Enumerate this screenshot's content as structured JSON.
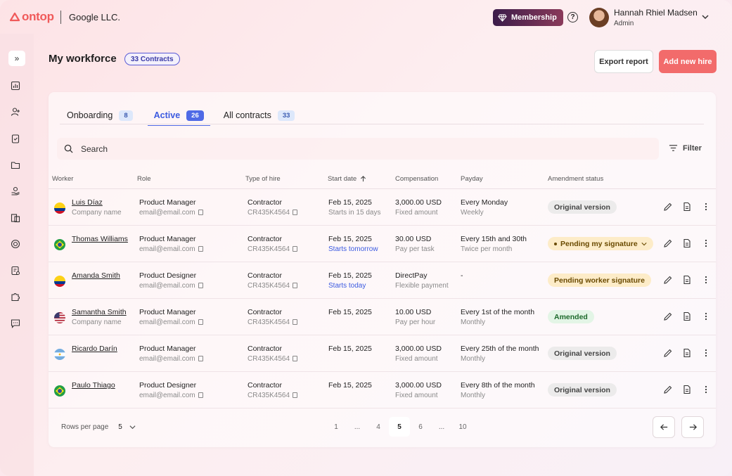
{
  "header": {
    "logo": "ontop",
    "company": "Google LLC.",
    "membership": "Membership",
    "help": "?",
    "user_name": "Hannah Rhiel Madsen",
    "user_role": "Admin"
  },
  "page": {
    "title": "My workforce",
    "contracts_badge": "33 Contracts",
    "export_label": "Export report",
    "add_label": "Add new hire"
  },
  "tabs": [
    {
      "label": "Onboarding",
      "count": "8"
    },
    {
      "label": "Active",
      "count": "26"
    },
    {
      "label": "All contracts",
      "count": "33"
    }
  ],
  "search": {
    "placeholder": "Search"
  },
  "filter_label": "Filter",
  "columns": [
    "Worker",
    "Role",
    "Type of hire",
    "Start date",
    "Compensation",
    "Payday",
    "Amendment status"
  ],
  "rows": [
    {
      "flag": "colombia",
      "name": "Luis Díaz",
      "sub": "Company name",
      "role": "Product Manager",
      "email": "email@email.com",
      "type": "Contractor",
      "id": "CR435K4564",
      "start": "Feb 15, 2025",
      "start_note": "Starts in 15 days",
      "start_note_style": "grey",
      "comp": "3,000.00 USD",
      "comp_note": "Fixed amount",
      "payday": "Every Monday",
      "payday_note": "Weekly",
      "status": "Original version",
      "status_style": "original"
    },
    {
      "flag": "brazil",
      "name": "Thomas Williams",
      "sub": "",
      "role": "Product Manager",
      "email": "email@email.com",
      "type": "Contractor",
      "id": "CR435K4564",
      "start": "Feb 15, 2025",
      "start_note": "Starts tomorrow",
      "start_note_style": "blue",
      "comp": "30.00 USD",
      "comp_note": "Pay per task",
      "payday": "Every 15th and 30th",
      "payday_note": "Twice per month",
      "status": "Pending my signature",
      "status_style": "pending-drop"
    },
    {
      "flag": "colombia",
      "name": "Amanda Smith",
      "sub": "",
      "role": "Product Designer",
      "email": "email@email.com",
      "type": "Contractor",
      "id": "CR435K4564",
      "start": "Feb 15, 2025",
      "start_note": "Starts today",
      "start_note_style": "blue",
      "comp": "DirectPay",
      "comp_note": "Flexible payment",
      "payday": "-",
      "payday_note": "",
      "status": "Pending worker signature",
      "status_style": "pending"
    },
    {
      "flag": "usa",
      "name": "Samantha Smith",
      "sub": "Company name",
      "role": "Product Manager",
      "email": "email@email.com",
      "type": "Contractor",
      "id": "CR435K4564",
      "start": "Feb 15, 2025",
      "start_note": "",
      "start_note_style": "grey",
      "comp": "10.00 USD",
      "comp_note": "Pay per hour",
      "payday": "Every 1st of the month",
      "payday_note": "Monthly",
      "status": "Amended",
      "status_style": "amended"
    },
    {
      "flag": "argentina",
      "name": "Ricardo Darín",
      "sub": "",
      "role": "Product Manager",
      "email": "email@email.com",
      "type": "Contractor",
      "id": "CR435K4564",
      "start": "Feb 15, 2025",
      "start_note": "",
      "start_note_style": "grey",
      "comp": "3,000.00 USD",
      "comp_note": "Fixed amount",
      "payday": "Every 25th of the month",
      "payday_note": "Monthly",
      "status": "Original version",
      "status_style": "original"
    },
    {
      "flag": "brazil",
      "name": "Paulo Thiago",
      "sub": "",
      "role": "Product Designer",
      "email": "email@email.com",
      "type": "Contractor",
      "id": "CR435K4564",
      "start": "Feb 15, 2025",
      "start_note": "",
      "start_note_style": "grey",
      "comp": "3,000.00 USD",
      "comp_note": "Fixed amount",
      "payday": "Every 8th of the month",
      "payday_note": "Monthly",
      "status": "Original version",
      "status_style": "original"
    }
  ],
  "footer": {
    "rows_per_page_label": "Rows per page",
    "rows_per_page_value": "5",
    "pages": [
      "1",
      "...",
      "4",
      "5",
      "6",
      "...",
      "10"
    ],
    "current_page": "5"
  },
  "colors": {
    "accent": "#f26b6b",
    "tab_active": "#4f6ae6",
    "brand": "#f05a5a"
  }
}
